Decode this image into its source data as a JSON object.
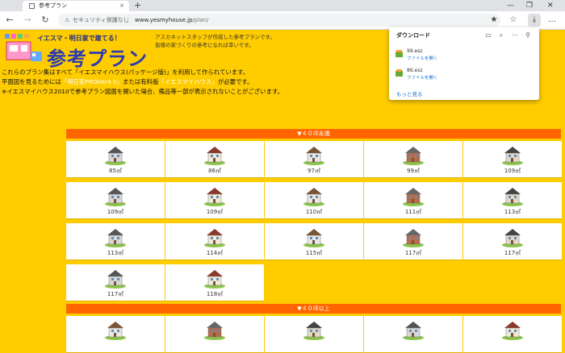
{
  "browser": {
    "tab_title": "参考プラン",
    "tab_close": "×",
    "new_tab": "+",
    "window_controls": [
      "—",
      "❐",
      "✕"
    ],
    "security_label": "セキュリティ保護なし",
    "separator": "|",
    "url_host": "www.yesmyhouse.jp",
    "url_path": "/plan/",
    "nav": {
      "back": "←",
      "forward": "→",
      "reload": "↻"
    },
    "toolbar_icons": [
      "★",
      "☆",
      "⧉",
      "⤓",
      "☆",
      "…"
    ]
  },
  "downloads": {
    "title": "ダウンロード",
    "items": [
      {
        "name": "99.esz",
        "action": "ファイルを開く"
      },
      {
        "name": "86.esz",
        "action": "ファイルを開く"
      }
    ],
    "more": "もっと見る",
    "header_icons": [
      "📁",
      "🔍",
      "…",
      "📌"
    ]
  },
  "header": {
    "slogan": "イエスマ・明日家で建てる！",
    "brand": "参考プラン",
    "intro_lines": [
      "アスカネットスタッフが作成した参考プランです。",
      "皆様の家づくりの参考になれば幸いです。"
    ]
  },
  "description": {
    "line1": "これらのプラン集はすべて「イエスマイハウス(パッケージ版)」を利用して作られています。",
    "line2_a": "平面図を見るためには",
    "line2_hl1": "「明日家PROVer4.0」",
    "line2_b": "または有料版",
    "line2_hl2": "「イエスマイハウス」",
    "line2_c": "が必要です。",
    "line3": "※イエスマイハウス2010で参考プラン図面を開いた場合、備品等一部が表示されないことがございます。"
  },
  "sections": [
    {
      "title": "▼４０坪未満",
      "plans": [
        "85㎡",
        "86㎡",
        "97㎡",
        "99㎡",
        "109㎡",
        "109㎡",
        "109㎡",
        "110㎡",
        "111㎡",
        "113㎡",
        "113㎡",
        "114㎡",
        "115㎡",
        "117㎡",
        "117㎡",
        "117㎡",
        "118㎡"
      ]
    },
    {
      "title": "▼４０坪以上",
      "plans": [
        "",
        "",
        "",
        "",
        ""
      ]
    }
  ],
  "colors": {
    "background": "#ffcc00",
    "section_header": "#ff6600",
    "brand": "#2b3bb0",
    "link": "#1a6fd0"
  }
}
